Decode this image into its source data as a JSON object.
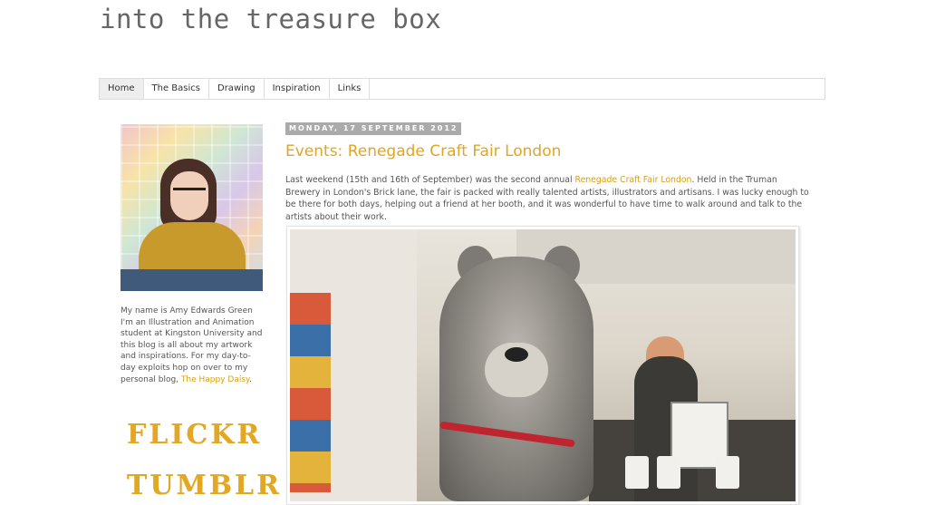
{
  "blog": {
    "title": "into the treasure box"
  },
  "nav": {
    "tabs": [
      {
        "label": "Home",
        "active": true
      },
      {
        "label": "The Basics"
      },
      {
        "label": "Drawing"
      },
      {
        "label": "Inspiration"
      },
      {
        "label": "Links"
      }
    ]
  },
  "sidebar": {
    "profile_text_prefix": "My name is Amy Edwards Green I'm an Illustration and Animation student at Kingston University and this blog is all about my artwork and inspirations. For my day-to-day exploits hop on over to my personal blog, ",
    "profile_link": "The Happy Daisy",
    "profile_text_suffix": ".",
    "links": [
      "FLICKR",
      "TUMBLR"
    ]
  },
  "post": {
    "date": "MONDAY, 17 SEPTEMBER 2012",
    "title": "Events: Renegade Craft Fair London",
    "body_prefix": "Last weekend (15th and 16th of September) was the second annual ",
    "body_link": "Renegade Craft Fair London",
    "body_suffix": ". Held in the Truman Brewery in London's Brick lane, the fair is packed with really talented artists, illustrators and artisans. I was lucky enough to be there for both days, helping out a friend at her booth, and it was wonderful to have time to walk around and talk to the artists about their work."
  },
  "colors": {
    "accent": "#e0a524",
    "text": "#555555",
    "date_bg": "#aaaaaa"
  }
}
